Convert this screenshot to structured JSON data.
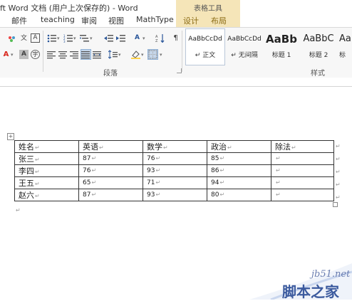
{
  "window": {
    "title": "ft Word 文档 (用户上次保存的) - Word"
  },
  "table_tools": {
    "label": "表格工具"
  },
  "tabs": [
    {
      "label": "邮件"
    },
    {
      "label": "teaching"
    },
    {
      "label": "审阅"
    },
    {
      "label": "视图"
    },
    {
      "label": "MathType"
    },
    {
      "label": "设计"
    },
    {
      "label": "布局"
    }
  ],
  "ribbon": {
    "groups": {
      "paragraph": "段落",
      "styles": "样式"
    },
    "font": {
      "font_color_glyph": "A",
      "char_shading_glyph": "A",
      "enclose_glyph": "字",
      "phonetic_glyph": "文"
    },
    "styles": [
      {
        "preview": "AaBbCcDd",
        "name": "↵ 正文"
      },
      {
        "preview": "AaBbCcDd",
        "name": "↵ 无间隔"
      },
      {
        "preview": "AaBb",
        "name": "标题 1"
      },
      {
        "preview": "AaBbC",
        "name": "标题 2"
      },
      {
        "preview": "Aa",
        "name": "标"
      }
    ]
  },
  "document": {
    "table": {
      "headers": [
        "姓名",
        "英语",
        "数学",
        "政治",
        "除法"
      ],
      "rows": [
        [
          "张三",
          "87",
          "76",
          "85",
          ""
        ],
        [
          "李四",
          "76",
          "93",
          "86",
          ""
        ],
        [
          "王五",
          "65",
          "71",
          "94",
          ""
        ],
        [
          "赵六",
          "87",
          "93",
          "80",
          ""
        ]
      ]
    }
  },
  "watermark": {
    "site": "jb51.net",
    "name": "脚本之家"
  },
  "colors": {
    "accent": "#2b579a",
    "table_tools": "#f5e5b8",
    "font_color_red": "#d9281e",
    "highlight_yellow": "#ffd24a"
  }
}
